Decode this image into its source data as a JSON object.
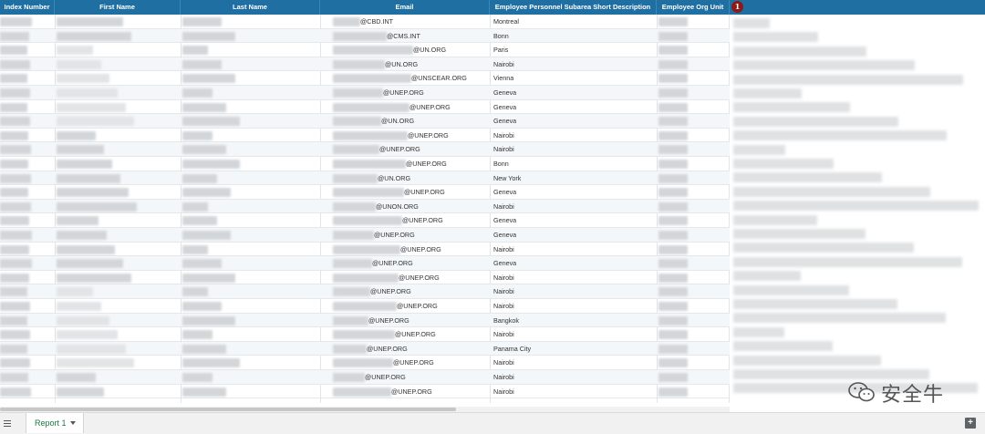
{
  "columns": [
    {
      "label": "Index Number"
    },
    {
      "label": "First Name"
    },
    {
      "label": "Last Name"
    },
    {
      "label": "Email"
    },
    {
      "label": "Employee Personnel Subarea Short Description"
    },
    {
      "label": "Employee Org Unit"
    }
  ],
  "badge": "1",
  "rows": [
    {
      "email": "@CBD.INT",
      "city": "Montreal"
    },
    {
      "email": "@CMS.INT",
      "city": "Bonn"
    },
    {
      "email": "@UN.ORG",
      "city": "Paris"
    },
    {
      "email": "@UN.ORG",
      "city": "Nairobi"
    },
    {
      "email": "@UNSCEAR.ORG",
      "city": "Vienna"
    },
    {
      "email": "@UNEP.ORG",
      "city": "Geneva"
    },
    {
      "email": "@UNEP.ORG",
      "city": "Geneva"
    },
    {
      "email": "@UN.ORG",
      "city": "Geneva"
    },
    {
      "email": "@UNEP.ORG",
      "city": "Nairobi"
    },
    {
      "email": "@UNEP.ORG",
      "city": "Nairobi"
    },
    {
      "email": "@UNEP.ORG",
      "city": "Bonn"
    },
    {
      "email": "@UN.ORG",
      "city": "New York"
    },
    {
      "email": "@UNEP.ORG",
      "city": "Geneva"
    },
    {
      "email": "@UNON.ORG",
      "city": "Nairobi"
    },
    {
      "email": "@UNEP.ORG",
      "city": "Geneva"
    },
    {
      "email": "@UNEP.ORG",
      "city": "Geneva"
    },
    {
      "email": "@UNEP.ORG",
      "city": "Nairobi"
    },
    {
      "email": "@UNEP.ORG",
      "city": "Geneva"
    },
    {
      "email": "@UNEP.ORG",
      "city": "Nairobi"
    },
    {
      "email": "@UNEP.ORG",
      "city": "Nairobi"
    },
    {
      "email": "@UNEP.ORG",
      "city": "Nairobi"
    },
    {
      "email": "@UNEP.ORG",
      "city": "Bangkok"
    },
    {
      "email": "@UNEP.ORG",
      "city": "Nairobi"
    },
    {
      "email": "@UNEP.ORG",
      "city": "Panama City"
    },
    {
      "email": "@UNEP.ORG",
      "city": "Nairobi"
    },
    {
      "email": "@UNEP.ORG",
      "city": "Nairobi"
    },
    {
      "email": "@UNEP.ORG",
      "city": "Nairobi"
    }
  ],
  "sheet_tab": {
    "label": "Report 1"
  },
  "add_sheet_icon": "plus-icon",
  "watermark": {
    "text": "安全牛",
    "icon": "wechat-icon"
  },
  "colors": {
    "header": "#1f6fa3",
    "tab_text": "#1a7a3c",
    "badge": "#8b1a1a"
  }
}
